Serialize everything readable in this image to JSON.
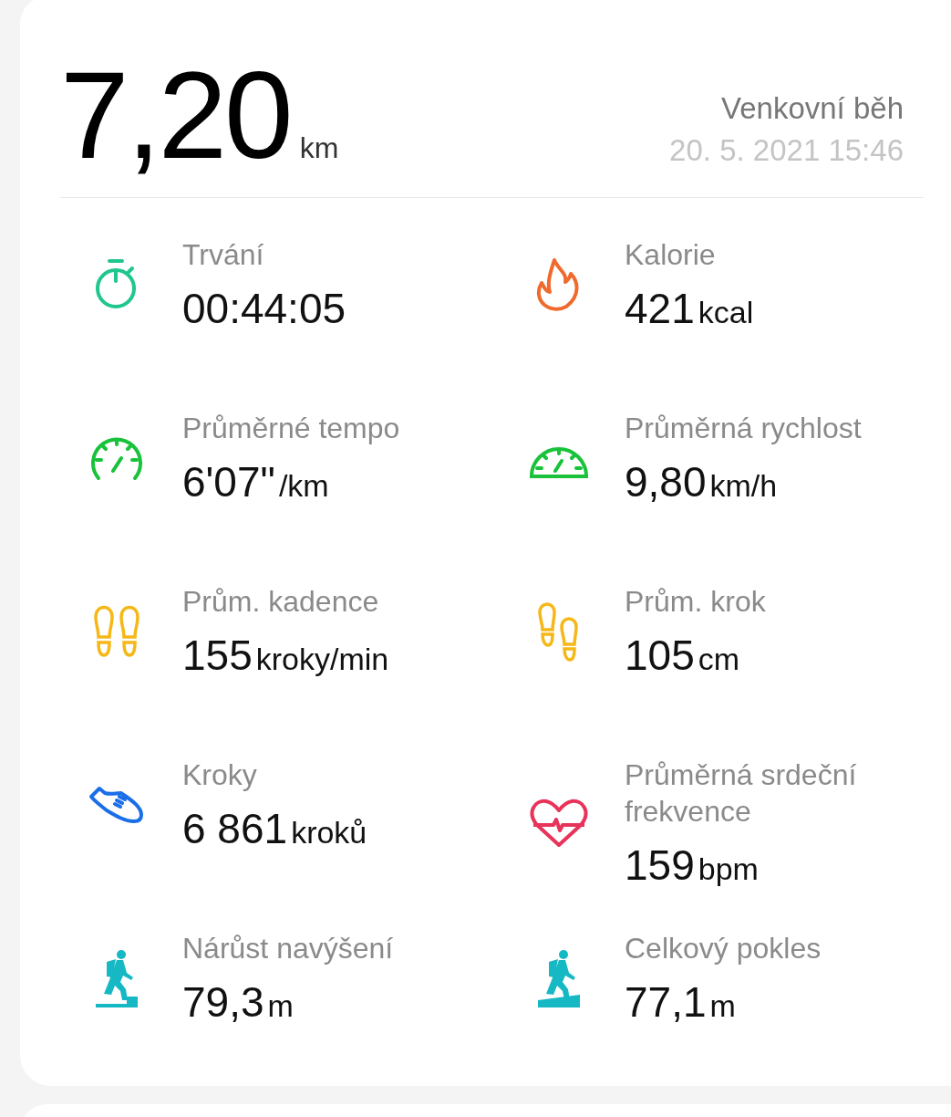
{
  "summary": {
    "distance": "7,20",
    "distance_unit": "km",
    "activity": "Venkovní běh",
    "date": "20. 5. 2021 15:46"
  },
  "metrics": [
    {
      "label": "Trvání",
      "value": "00:44:05",
      "kind": "stopwatch",
      "color": "#1fc78e"
    },
    {
      "label": "Kalorie",
      "value": "421",
      "unit": "kcal",
      "kind": "flame",
      "color": "#ef6a2c"
    },
    {
      "label": "Průměrné tempo",
      "value": "6'07\"",
      "unit": "/km",
      "kind": "pace",
      "color": "#19c23a"
    },
    {
      "label": "Průměrná rychlost",
      "value": "9,80",
      "unit": "km/h",
      "kind": "speed",
      "color": "#19c23a"
    },
    {
      "label": "Prům. kadence",
      "value": "155",
      "unit": "kroky/min",
      "kind": "cadence",
      "color": "#f5b818"
    },
    {
      "label": "Prům. krok",
      "value": "105",
      "unit": "cm",
      "kind": "stride",
      "color": "#f5b818"
    },
    {
      "label": "Kroky",
      "value": "6 861",
      "unit": "kroků",
      "kind": "steps",
      "color": "#1a6fe8"
    },
    {
      "label": "Průměrná srdeční frekvence",
      "value": "159",
      "unit": "bpm",
      "kind": "heart",
      "color": "#e8335a"
    },
    {
      "label": "Nárůst navýšení",
      "value": "79,3",
      "unit": "m",
      "kind": "ascent",
      "color": "#16b8c4"
    },
    {
      "label": "Celkový pokles",
      "value": "77,1",
      "unit": "m",
      "kind": "descent",
      "color": "#16b8c4"
    }
  ]
}
